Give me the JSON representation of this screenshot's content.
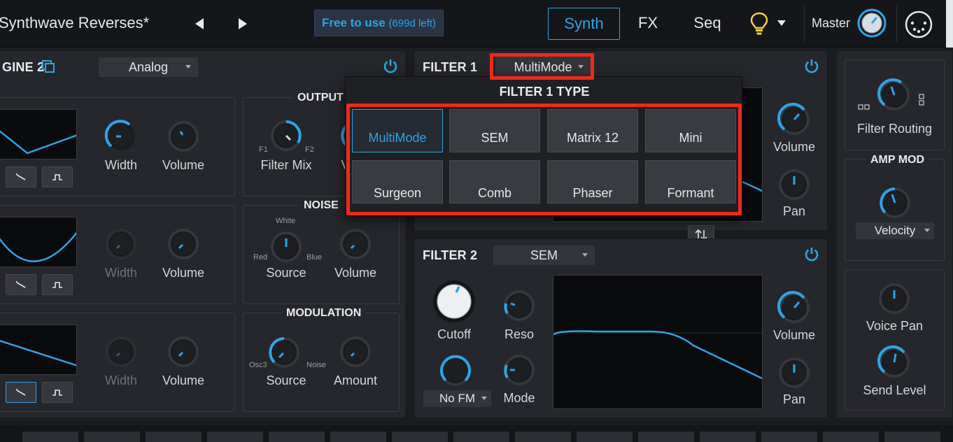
{
  "header": {
    "preset_name": "Synthwave Reverses*",
    "license_label": "Free to use",
    "license_days": "(699d left)",
    "tabs": [
      {
        "label": "Synth",
        "active": true
      },
      {
        "label": "FX",
        "active": false
      },
      {
        "label": "Seq",
        "active": false
      }
    ],
    "master_label": "Master",
    "icons": [
      "prev-arrow-icon",
      "next-arrow-icon",
      "lightbulb-icon",
      "dropdown-caret-icon",
      "midi-icon"
    ]
  },
  "engine2": {
    "title": "GINE 2",
    "engine_type": "Analog",
    "osc_rows": [
      {
        "width_label": "Width",
        "volume_label": "Volume",
        "width_active": true
      },
      {
        "width_label": "Width",
        "volume_label": "Volume",
        "width_active": false
      },
      {
        "width_label": "Width",
        "volume_label": "Volume",
        "width_active": false
      }
    ],
    "output": {
      "title": "OUTPUT",
      "filter_mix_label": "Filter Mix",
      "f1": "F1",
      "f2": "F2",
      "volume_label": "Vo"
    },
    "noise": {
      "title": "NOISE",
      "source_label": "Source",
      "volume_label": "Volume",
      "white": "White",
      "red": "Red",
      "blue": "Blue"
    },
    "modulation": {
      "title": "MODULATION",
      "source_label": "Source",
      "amount_label": "Amount",
      "osc3": "Osc3",
      "noise": "Noise"
    }
  },
  "filter1": {
    "title": "FILTER 1",
    "type_value": "MultiMode",
    "volume_label": "Volume",
    "pan_label": "Pan",
    "popup": {
      "title": "FILTER 1 TYPE",
      "options": [
        {
          "label": "MultiMode",
          "selected": true
        },
        {
          "label": "SEM",
          "selected": false
        },
        {
          "label": "Matrix 12",
          "selected": false
        },
        {
          "label": "Mini",
          "selected": false
        },
        {
          "label": "Surgeon",
          "selected": false
        },
        {
          "label": "Comb",
          "selected": false
        },
        {
          "label": "Phaser",
          "selected": false
        },
        {
          "label": "Formant",
          "selected": false
        }
      ]
    }
  },
  "filter2": {
    "title": "FILTER 2",
    "type_value": "SEM",
    "cutoff_label": "Cutoff",
    "reso_label": "Reso",
    "fm_value": "No FM",
    "mode_label": "Mode",
    "volume_label": "Volume",
    "pan_label": "Pan"
  },
  "routing": {
    "filter_routing_label": "Filter Routing",
    "amp_mod_title": "AMP MOD",
    "amp_mod_source": "Velocity",
    "voice_pan_label": "Voice Pan",
    "send_level_label": "Send Level"
  },
  "colors": {
    "accent": "#2fa3e6",
    "highlight": "#ee2a1a",
    "panel": "#26272c"
  }
}
